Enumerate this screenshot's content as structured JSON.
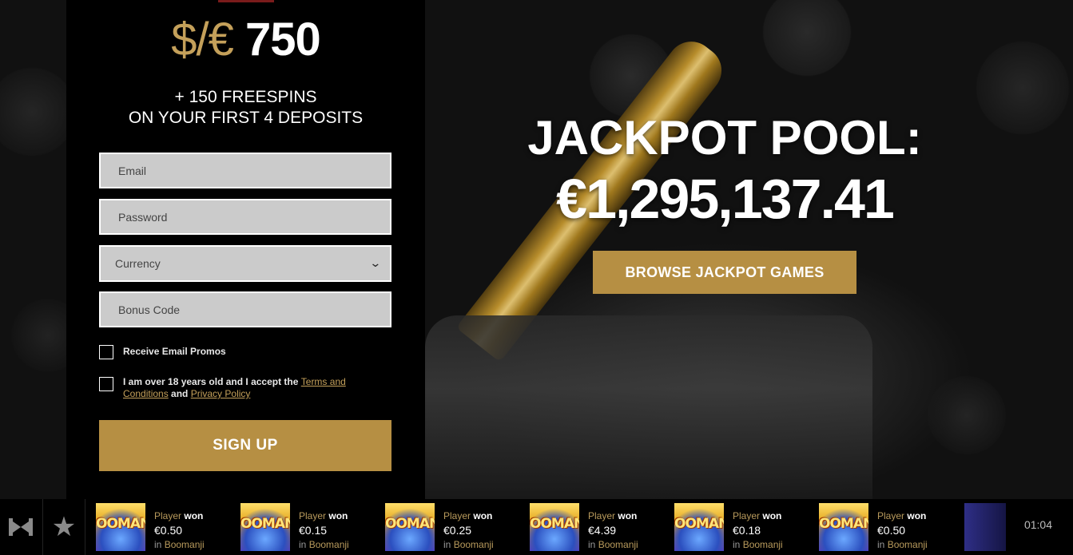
{
  "colors": {
    "gold": "#b68f43",
    "gold_text": "#c4a05a",
    "panel_bg": "#000000",
    "field_bg": "#cbcbcb"
  },
  "hero": {
    "amount_prefix": "$/€",
    "amount_value": "750",
    "promo_line1": "+ 150 FREESPINS",
    "promo_line2": "ON YOUR FIRST 4 DEPOSITS"
  },
  "form": {
    "email_placeholder": "Email",
    "password_placeholder": "Password",
    "currency_label": "Currency",
    "bonus_placeholder": "Bonus Code",
    "promos_label": "Receive Email Promos",
    "terms_prefix": "I am over 18 years old and I accept the ",
    "terms_link": "Terms and Conditions",
    "terms_and": " and ",
    "privacy_link": "Privacy Policy",
    "signup_label": "SIGN UP"
  },
  "jackpot": {
    "title": "JACKPOT POOL:",
    "value": "€1,295,137.41",
    "browse_label": "BROWSE JACKPOT GAMES"
  },
  "ticker": {
    "logo_icon": "brand-logo-icon",
    "fav_icon": "star-icon",
    "wins": [
      {
        "player": "Player",
        "won": "won",
        "amount": "€0.50",
        "in": "in",
        "game": "Boomanji"
      },
      {
        "player": "Player",
        "won": "won",
        "amount": "€0.15",
        "in": "in",
        "game": "Boomanji"
      },
      {
        "player": "Player",
        "won": "won",
        "amount": "€0.25",
        "in": "in",
        "game": "Boomanji"
      },
      {
        "player": "Player",
        "won": "won",
        "amount": "€4.39",
        "in": "in",
        "game": "Boomanji"
      },
      {
        "player": "Player",
        "won": "won",
        "amount": "€0.18",
        "in": "in",
        "game": "Boomanji"
      },
      {
        "player": "Player",
        "won": "won",
        "amount": "€0.50",
        "in": "in",
        "game": "Boomanji"
      }
    ],
    "thumb_text": "OOMAN",
    "clock": "01:04"
  }
}
